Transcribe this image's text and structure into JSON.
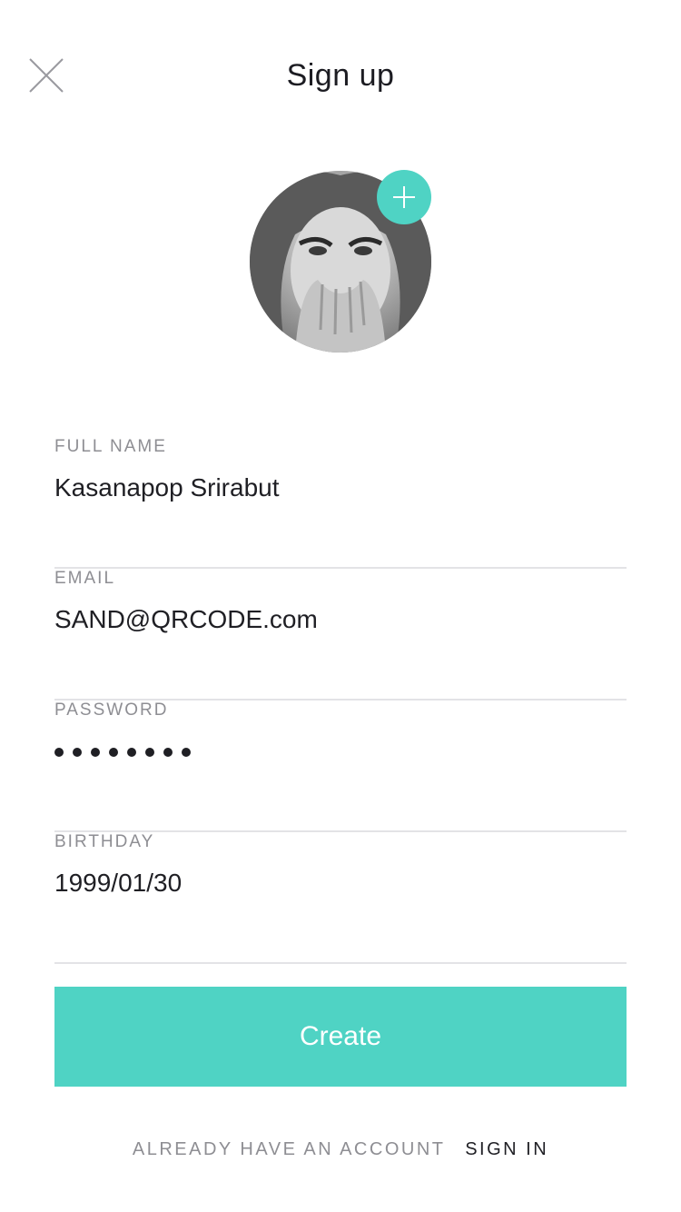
{
  "header": {
    "title": "Sign up",
    "close_icon": "close-icon"
  },
  "avatar": {
    "add_icon": "plus-icon",
    "accent_color": "#4fd3c4"
  },
  "form": {
    "fields": [
      {
        "label": "FULL NAME",
        "value": "Kasanapop Srirabut"
      },
      {
        "label": "EMAIL",
        "value": "SAND@QRCODE.com"
      },
      {
        "label": "PASSWORD",
        "masked_length": 8
      },
      {
        "label": "BIRTHDAY",
        "value": "1999/01/30"
      }
    ]
  },
  "actions": {
    "create_label": "Create"
  },
  "footer": {
    "prompt": "ALREADY HAVE AN ACCOUNT",
    "link": "SIGN IN"
  },
  "colors": {
    "accent": "#4fd3c4",
    "text": "#1f1f24",
    "label": "#8e8e93",
    "divider": "#e3e3e6"
  }
}
